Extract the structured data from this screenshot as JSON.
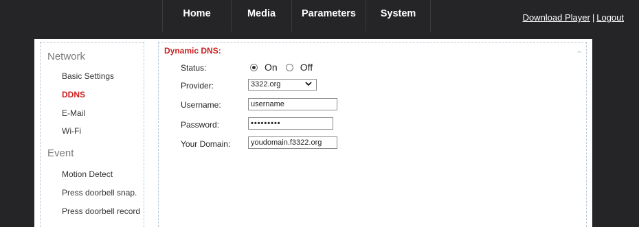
{
  "nav": {
    "home": "Home",
    "media": "Media",
    "parameters": "Parameters",
    "system": "System"
  },
  "top_links": {
    "download_player": "Download Player",
    "separator": "|",
    "logout": "Logout"
  },
  "sidebar": {
    "network_title": "Network",
    "network_items": [
      "Basic Settings",
      "DDNS",
      "E-Mail",
      "Wi-Fi"
    ],
    "active_item": "DDNS",
    "event_title": "Event",
    "event_items": [
      "Motion Detect",
      "Press doorbell snap.",
      "Press doorbell record"
    ]
  },
  "form": {
    "title": "Dynamic DNS:",
    "status_label": "Status:",
    "status_on": "On",
    "status_off": "Off",
    "status_value": "On",
    "provider_label": "Provider:",
    "provider_value": "3322.org",
    "username_label": "Username:",
    "username_value": "username",
    "password_label": "Password:",
    "password_value": "•••••••••",
    "domain_label": "Your Domain:",
    "domain_value": "youdomain.f3322.org"
  },
  "colors": {
    "background": "#252528",
    "accent_red": "#cc1f1f",
    "panel": "#ffffff",
    "dashed_border": "#b9c6d6"
  },
  "icons": {
    "provider_dropdown": "chevron-down-icon",
    "scroll_up": "chevron-up-icon"
  }
}
